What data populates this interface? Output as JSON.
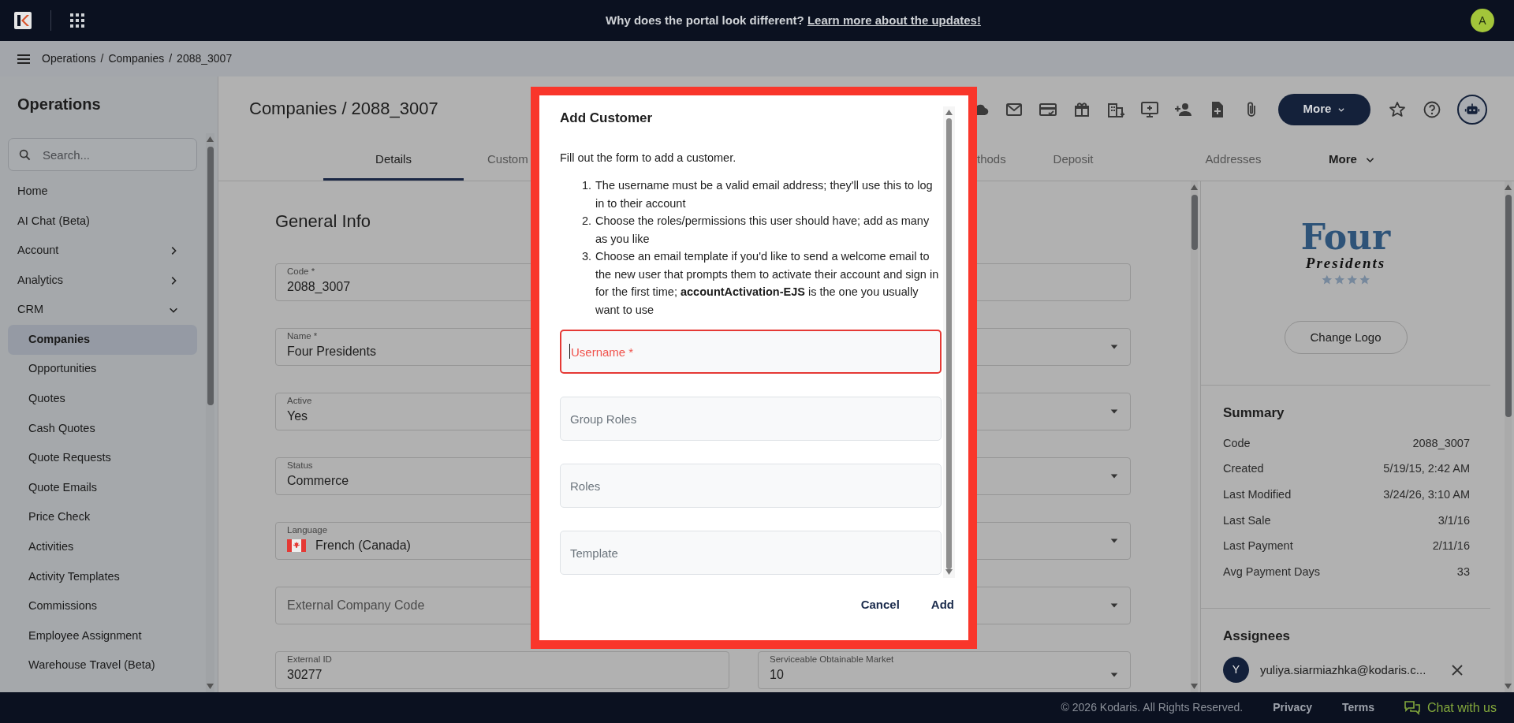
{
  "top_bar": {
    "message": "Why does the portal look different?",
    "link": "Learn more about the updates!",
    "avatar": "A"
  },
  "breadcrumbs": {
    "separator": "/",
    "items": [
      "Operations",
      "Companies",
      "2088_3007"
    ]
  },
  "sidebar": {
    "title": "Operations",
    "search": {
      "placeholder": "Search..."
    },
    "items": [
      {
        "label": "Home",
        "kind": "link",
        "selected": false
      },
      {
        "label": "AI Chat (Beta)",
        "kind": "link",
        "selected": false
      },
      {
        "label": "Account",
        "kind": "group",
        "expanded": false,
        "selected": false
      },
      {
        "label": "Analytics",
        "kind": "group",
        "expanded": false,
        "selected": false
      },
      {
        "label": "CRM",
        "kind": "group",
        "expanded": true,
        "selected": false,
        "children": [
          {
            "label": "Companies",
            "selected": true
          },
          {
            "label": "Opportunities",
            "selected": false
          },
          {
            "label": "Quotes",
            "selected": false
          },
          {
            "label": "Cash Quotes",
            "selected": false
          },
          {
            "label": "Quote Requests",
            "selected": false
          },
          {
            "label": "Quote Emails",
            "selected": false
          },
          {
            "label": "Price Check",
            "selected": false
          },
          {
            "label": "Activities",
            "selected": false
          },
          {
            "label": "Activity Templates",
            "selected": false
          },
          {
            "label": "Commissions",
            "selected": false
          },
          {
            "label": "Employee Assignment",
            "selected": false
          },
          {
            "label": "Warehouse Travel (Beta)",
            "selected": false
          }
        ]
      }
    ]
  },
  "page": {
    "title": "Companies / 2088_3007",
    "more_button": "More",
    "tabs": [
      {
        "label": "Details",
        "selected": true,
        "kind": "tab"
      },
      {
        "label": "Custom",
        "selected": false,
        "kind": "tab"
      },
      {
        "label": "thods",
        "selected": false,
        "kind": "tab"
      },
      {
        "label": "Deposit",
        "selected": false,
        "kind": "tab"
      },
      {
        "label": "Addresses",
        "selected": false,
        "kind": "tab"
      },
      {
        "label": "More",
        "selected": false,
        "kind": "menu"
      }
    ]
  },
  "general_info": {
    "title": "General Info",
    "left_fields": [
      {
        "label": "Code *",
        "value": "2088_3007"
      },
      {
        "label": "Name *",
        "value": "Four Presidents"
      },
      {
        "label": "Active",
        "value": "Yes"
      },
      {
        "label": "Status",
        "value": "Commerce"
      },
      {
        "label": "Language",
        "value": "French (Canada)",
        "kind": "flag"
      },
      {
        "placeholder": "External Company Code"
      },
      {
        "label": "External ID",
        "value": "30277"
      }
    ],
    "right_fields": [
      {
        "dropdown": false
      },
      {
        "dropdown": true
      },
      {
        "dropdown": true
      },
      {
        "dropdown": true
      },
      {
        "dropdown": true
      },
      {
        "dropdown": true
      },
      {
        "label": "Serviceable Obtainable Market",
        "value": "10",
        "dropdown": true
      }
    ]
  },
  "side_panel": {
    "logo": {
      "title": "Four",
      "subtitle": "Presidents"
    },
    "logo_button": "Change Logo",
    "summary": {
      "title": "Summary",
      "rows": [
        {
          "label": "Code",
          "value": "2088_3007"
        },
        {
          "label": "Created",
          "value": "5/19/15, 2:42 AM"
        },
        {
          "label": "Last Modified",
          "value": "3/24/26, 3:10 AM"
        },
        {
          "label": "Last Sale",
          "value": "3/1/16"
        },
        {
          "label": "Last Payment",
          "value": "2/11/16"
        },
        {
          "label": "Avg Payment Days",
          "value": "33"
        }
      ]
    },
    "assignees": {
      "title": "Assignees",
      "items": [
        {
          "initial": "Y",
          "email": "yuliya.siarmiazhka@kodaris.c..."
        }
      ]
    }
  },
  "modal": {
    "title": "Add Customer",
    "intro": "Fill out the form to add a customer.",
    "steps": [
      {
        "number": "1.",
        "text": "The username must be a valid email address; they'll use this to log in to their account"
      },
      {
        "number": "2.",
        "text": "Choose the roles/permissions this user should have; add as many as you like"
      },
      {
        "number": "3.",
        "text": "Choose an email template if you'd like to send a welcome email to the new user that prompts them to activate their account and sign in for the first time; **accountActivation-EJS** is the one you usually want to use"
      }
    ],
    "fields": [
      {
        "placeholder": "Username *",
        "focused": true,
        "error": true
      },
      {
        "placeholder": "Group Roles",
        "focused": false,
        "error": false
      },
      {
        "placeholder": "Roles",
        "focused": false,
        "error": false
      },
      {
        "placeholder": "Template",
        "focused": false,
        "error": false
      }
    ],
    "buttons": [
      "Cancel",
      "Add"
    ]
  },
  "footer": {
    "copyright": "© 2026 Kodaris. All Rights Reserved.",
    "links": [
      "Privacy",
      "Terms"
    ],
    "chat": "Chat with us"
  }
}
